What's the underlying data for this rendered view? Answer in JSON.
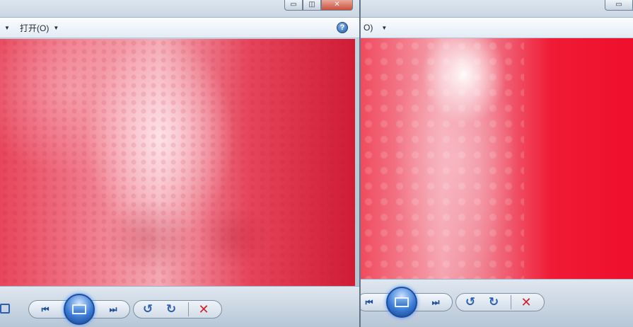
{
  "left_window": {
    "controls": {
      "minimize_icon": "▭",
      "maximize_icon": "◫",
      "close_icon": "✕"
    },
    "menu": {
      "open_label": "打开(O)",
      "help_icon": "?"
    },
    "photo": {
      "dominant_color": "#e6455c"
    },
    "toolbar": {
      "prev_icon": "⏮",
      "next_icon": "⏭",
      "rotate_ccw_icon": "↺",
      "rotate_cw_icon": "↻",
      "delete_icon": "✕"
    }
  },
  "right_window": {
    "controls": {
      "minimize_icon": "▭"
    },
    "menu": {
      "open_label": "O)"
    },
    "photo": {
      "dominant_color": "#ee0f2c"
    },
    "toolbar": {
      "prev_icon": "⏮",
      "next_icon": "⏭",
      "rotate_ccw_icon": "↺",
      "rotate_cw_icon": "↻",
      "delete_icon": "✕"
    }
  }
}
